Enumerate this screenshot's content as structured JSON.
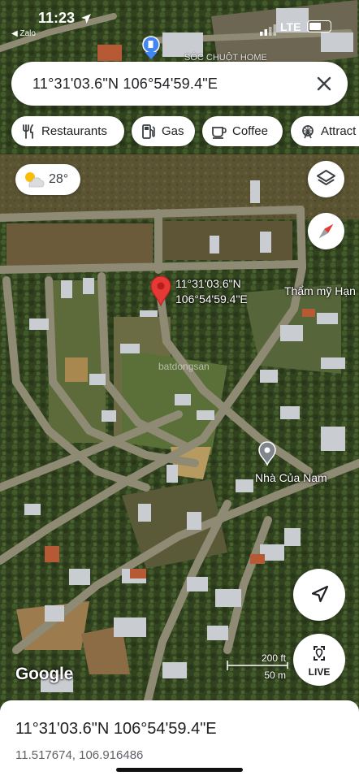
{
  "status_bar": {
    "time": "11:23",
    "back_app": "◀ Zalo",
    "network": "LTE",
    "battery_level": 0.6
  },
  "search": {
    "value": "11°31'03.6\"N 106°54'59.4\"E",
    "clear_icon": "close-icon"
  },
  "chips": [
    {
      "label": "Restaurants",
      "icon": "fork-knife-icon"
    },
    {
      "label": "Gas",
      "icon": "gas-pump-icon"
    },
    {
      "label": "Coffee",
      "icon": "coffee-cup-icon"
    },
    {
      "label": "Attract",
      "icon": "ferris-wheel-icon"
    }
  ],
  "weather": {
    "temperature": "28°",
    "icon": "partly-cloudy-icon"
  },
  "map": {
    "type": "satellite",
    "dropped_pin": {
      "line1": "11°31'03.6\"N",
      "line2": "106°54'59.4\"E",
      "color": "#e53935"
    },
    "places": [
      {
        "name": "Thẩm mỹ Hạn"
      },
      {
        "name": "Nhà Của Nam"
      }
    ],
    "faded_label": "SÓC CHUỘT HOME",
    "watermark": "batdongsan",
    "scale": {
      "feet": "200 ft",
      "meters": "50 m"
    },
    "attribution": "Google"
  },
  "controls": {
    "layers_icon": "layers-icon",
    "compass_icon": "compass-icon",
    "locate_icon": "navigation-arrow-icon",
    "live_label": "LIVE"
  },
  "bottom_sheet": {
    "title": "11°31'03.6\"N 106°54'59.4\"E",
    "decimal": "11.517674, 106.916486"
  }
}
